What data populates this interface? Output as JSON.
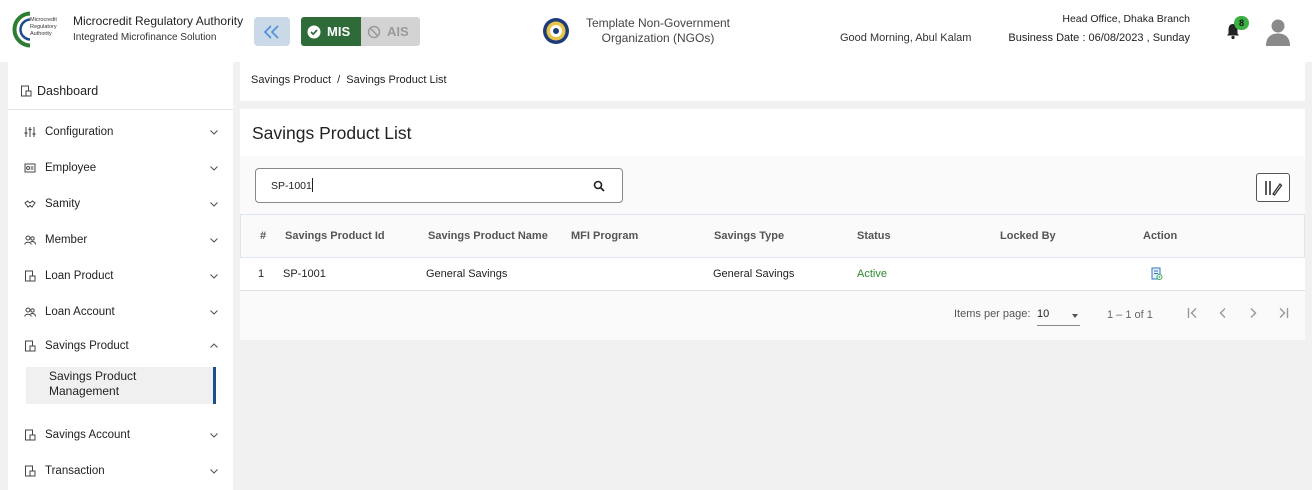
{
  "header": {
    "brand_title": "Microcredit Regulatory Authority",
    "brand_subtitle": "Integrated Microfinance Solution",
    "logo_text": "Microcredit Regulatory Authority",
    "mis_label": "MIS",
    "ais_label": "AIS",
    "org_line1": "Template Non-Government",
    "org_line2": "Organization (NGOs)",
    "greeting": "Good Morning, Abul Kalam",
    "branch": "Head Office, Dhaka Branch",
    "business_date": "Business Date : 06/08/2023 , Sunday",
    "notification_count": "8",
    "accent_green": "#2e6b39",
    "accent_blue": "#1f4e8c"
  },
  "sidebar": {
    "dashboard_label": "Dashboard",
    "items": [
      {
        "label": "Configuration",
        "icon": "sliders-icon",
        "expanded": false
      },
      {
        "label": "Employee",
        "icon": "id-card-icon",
        "expanded": false
      },
      {
        "label": "Samity",
        "icon": "handshake-icon",
        "expanded": false
      },
      {
        "label": "Member",
        "icon": "users-icon",
        "expanded": false
      },
      {
        "label": "Loan Product",
        "icon": "document-icon",
        "expanded": false
      },
      {
        "label": "Loan Account",
        "icon": "users-icon",
        "expanded": false
      },
      {
        "label": "Savings Product",
        "icon": "document-icon",
        "expanded": true
      },
      {
        "label": "Savings Account",
        "icon": "document-icon",
        "expanded": false
      },
      {
        "label": "Transaction",
        "icon": "document-icon",
        "expanded": false
      }
    ],
    "sub_item_line1": "Savings Product",
    "sub_item_line2": "Management"
  },
  "breadcrumb": {
    "parent": "Savings Product",
    "separator": "/",
    "current": "Savings Product List"
  },
  "main": {
    "title": "Savings Product List",
    "search_value": "SP-1001",
    "columns": [
      "#",
      "Savings Product Id",
      "Savings Product Name",
      "MFI Program",
      "Savings Type",
      "Status",
      "Locked By",
      "Action"
    ],
    "rows": [
      {
        "num": "1",
        "id": "SP-1001",
        "name": "General Savings",
        "mfi_program": "",
        "savings_type": "General Savings",
        "status": "Active",
        "locked_by": ""
      }
    ],
    "status_color": "#2e8b2e",
    "pagination": {
      "items_per_page_label": "Items per page:",
      "items_per_page_value": "10",
      "range": "1 – 1 of 1"
    }
  }
}
